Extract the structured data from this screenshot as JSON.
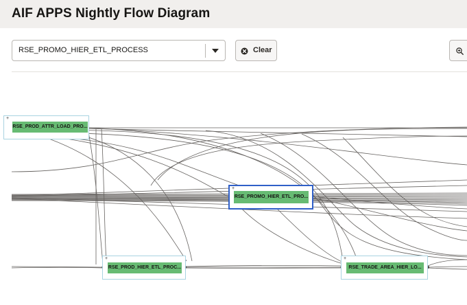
{
  "app": {
    "title": "AIF APPS Nightly Flow Diagram"
  },
  "toolbar": {
    "process_select": {
      "value": "RSE_PROMO_HIER_ETL_PROCESS"
    },
    "clear_label": "Clear"
  },
  "diagram": {
    "nodes": [
      {
        "id": "prod-attr",
        "label": "RSE_PROD_ATTR_LOAD_PRO...",
        "selected": false
      },
      {
        "id": "promo-hier",
        "label": "RSE_PROMO_HIER_ETL_PRO...",
        "selected": true
      },
      {
        "id": "prod-hier",
        "label": "RSE_PROD_HIER_ETL_PROC...",
        "selected": false
      },
      {
        "id": "trade-area",
        "label": "RSE_TRADE_AREA_HIER_LO...",
        "selected": false
      }
    ]
  },
  "colors": {
    "node_fill": "#67bb73",
    "node_border": "#a9d3e1",
    "selected_border": "#2f5fc8",
    "edge": "#4a4643"
  }
}
